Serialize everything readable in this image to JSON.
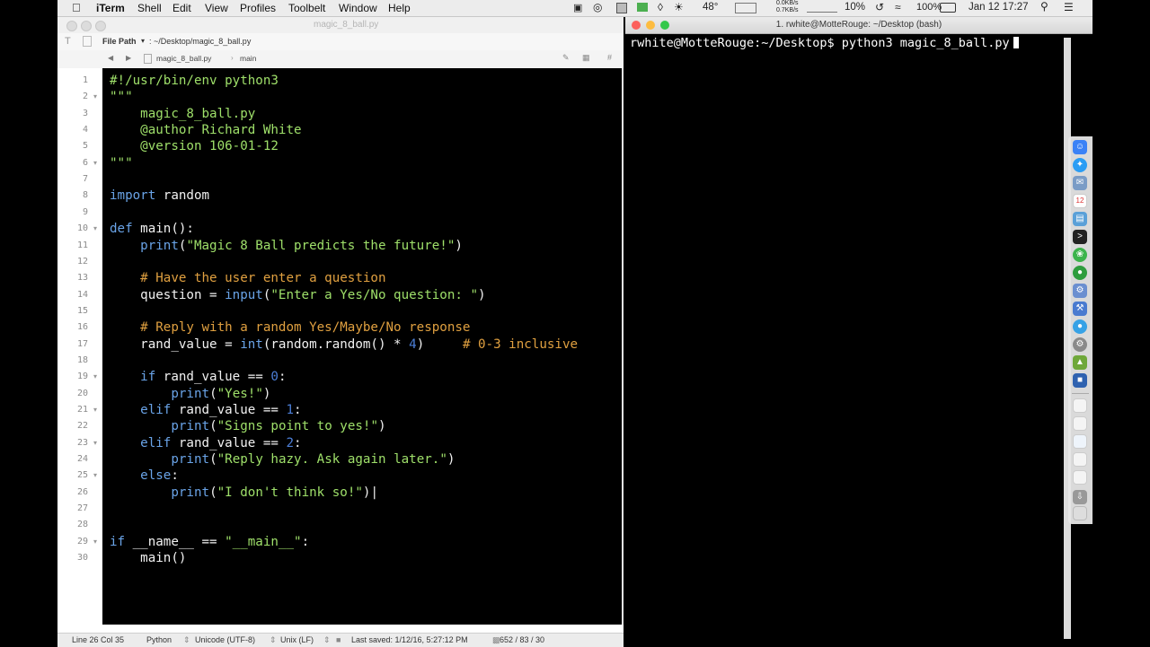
{
  "menubar": {
    "app": "iTerm",
    "items": [
      "Shell",
      "Edit",
      "View",
      "Profiles",
      "Toolbelt",
      "Window",
      "Help"
    ],
    "status": {
      "temp": "48°",
      "net_down": "0.0KB/s",
      "net_up": "0.7KB/s",
      "cpu": "10%",
      "battery": "100%",
      "datetime": "Jan 12  17:27"
    }
  },
  "editor": {
    "tab_title": "magic_8_ball.py",
    "path_label": "File Path",
    "path_value": ": ~/Desktop/magic_8_ball.py",
    "file_name": "magic_8_ball.py",
    "func_name": "main",
    "lines": [
      "#!/usr/bin/env python3",
      "\"\"\"",
      "    magic_8_ball.py",
      "    @author Richard White",
      "    @version 106-01-12",
      "\"\"\"",
      "",
      "import random",
      "",
      "def main():",
      "    print(\"Magic 8 Ball predicts the future!\")",
      "",
      "    # Have the user enter a question",
      "    question = input(\"Enter a Yes/No question: \")",
      "",
      "    # Reply with a random Yes/Maybe/No response",
      "    rand_value = int(random.random() * 4)     # 0-3 inclusive",
      "",
      "    if rand_value == 0:",
      "        print(\"Yes!\")",
      "    elif rand_value == 1:",
      "        print(\"Signs point to yes!\")",
      "    elif rand_value == 2:",
      "        print(\"Reply hazy. Ask again later.\")",
      "    else:",
      "        print(\"I don't think so!\")",
      "",
      "",
      "if __name__ == \"__main__\":",
      "    main()"
    ],
    "status": {
      "position": "Line 26 Col 35",
      "language": "Python",
      "encoding": "Unicode (UTF-8)",
      "line_endings": "Unix (LF)",
      "saved": "Last saved: 1/12/16, 5:27:12 PM",
      "counts": "652 / 83 / 30"
    }
  },
  "terminal": {
    "title": "1. rwhite@MotteRouge: ~/Desktop (bash)",
    "prompt": "rwhite@MotteRouge:~/Desktop$ python3 magic_8_ball.py"
  },
  "colors": {
    "keyword": "#6aa4e8",
    "string": "#9fe06a",
    "comment": "#e0a040",
    "number": "#4c7fd8",
    "code_bg": "#000000"
  }
}
